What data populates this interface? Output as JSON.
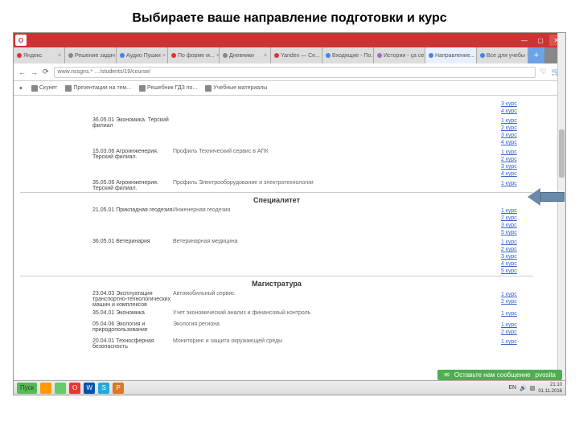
{
  "page": {
    "title": "Выбираете ваше направление подготовки и курс"
  },
  "titlebar": {
    "opera": "O"
  },
  "tabs": [
    {
      "label": "Яндекс",
      "dot": "r"
    },
    {
      "label": "Решение задач",
      "dot": ""
    },
    {
      "label": "Аудио Пушки",
      "dot": "g"
    },
    {
      "label": "По форме м...",
      "dot": "r"
    },
    {
      "label": "Дневники",
      "dot": ""
    },
    {
      "label": "Yandex — Се...",
      "dot": "r"
    },
    {
      "label": "Входящие - По...",
      "dot": "g"
    },
    {
      "label": "Истории - ça ce",
      "dot": "p"
    },
    {
      "label": "Направление...",
      "dot": "g",
      "active": true
    },
    {
      "label": "Все для учебы",
      "dot": "g"
    }
  ],
  "nav": {
    "back": "←",
    "fwd": "→",
    "reload": "⟳",
    "url": "www.nssgns.* …/students/19/course/"
  },
  "bookmarks": [
    {
      "label": "Скунет"
    },
    {
      "label": "Презентации на тем..."
    },
    {
      "label": "Решебник ГДЗ по..."
    },
    {
      "label": "Учебные материалы"
    }
  ],
  "rows1": [
    {
      "c1": "",
      "c2": "",
      "courses": [
        "3 курс",
        "4 курс"
      ]
    },
    {
      "c1": "36.05.01 Экономика. Терский филиал",
      "c2": "",
      "courses": [
        "1 курс",
        "2 курс",
        "3 курс",
        "4 курс"
      ]
    },
    {
      "c1": "15.03.06 Агроинженерия. Терский филиал.",
      "c2": "Профиль Технический сервис в АПК",
      "courses": [
        "1 курс",
        "2 курс",
        "3 курс",
        "4 курс"
      ]
    },
    {
      "c1": "35.05.06 Агроинженерия. Терский филиал.",
      "c2": "Профиль Электрооборудование и электротехнологии",
      "courses": [
        "1 курс"
      ]
    }
  ],
  "sections": {
    "spec": "Специалитет",
    "mag": "Магистратура"
  },
  "rows2": [
    {
      "c1": "21.05.01 Прикладная геодезия",
      "c2": "Инженерная геодезия",
      "courses": [
        "1 курс",
        "2 курс",
        "3 курс",
        "5 курс"
      ]
    },
    {
      "c1": "36.05.01 Ветеринария",
      "c2": "Ветеринарная медицина",
      "courses": [
        "1 курс",
        "2 курс",
        "3 курс",
        "4 курс",
        "5 курс"
      ]
    }
  ],
  "rows3": [
    {
      "c1": "23.04.03 Эксплуатация транспортно-технологических машин и комплексов",
      "c2": "Автомобильный сервис",
      "courses": [
        "1 курс",
        "2 курс"
      ]
    },
    {
      "c1": "35.04.01 Экономика",
      "c2": "Учет экономический анализ и финансовый контроль",
      "courses": [
        "1 курс"
      ]
    },
    {
      "c1": "05.04.06 Экология и природопользование",
      "c2": "Экология региона",
      "courses": [
        "1 курс",
        "2 курс"
      ]
    },
    {
      "c1": "20.04.01 Техносферная безопасность",
      "c2": "Мониторинг и защита окружающей среды",
      "courses": [
        "1 курс"
      ]
    }
  ],
  "status": {
    "msg": "Оставьте нам сообщение",
    "user": "pvosita"
  },
  "taskbar": {
    "start": "Пуск",
    "icons": [
      {
        "bg": "#f90",
        "t": ""
      },
      {
        "bg": "#6c6",
        "t": ""
      },
      {
        "bg": "#e33",
        "t": "O"
      },
      {
        "bg": "#05a",
        "t": "W"
      },
      {
        "bg": "#2ad",
        "t": "S"
      },
      {
        "bg": "#d72",
        "t": "P"
      }
    ],
    "tray": "EN",
    "time": "21:10",
    "date": "01.11.2016"
  }
}
